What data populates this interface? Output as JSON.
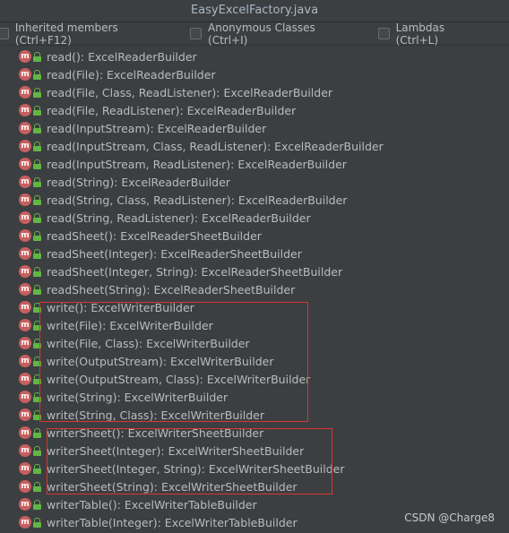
{
  "window": {
    "title": "EasyExcelFactory.java"
  },
  "options": [
    {
      "label": "Inherited members (Ctrl+F12)",
      "checked": false
    },
    {
      "label": "Anonymous Classes (Ctrl+I)",
      "checked": false
    },
    {
      "label": "Lambdas (Ctrl+L)",
      "checked": false
    }
  ],
  "icons": {
    "method": "method-icon",
    "visibility": "public-lock-icon"
  },
  "colors": {
    "method_icon": "#c75f5f",
    "lock_icon": "#62b543",
    "highlight_box": "#d9362f"
  },
  "members": [
    "read(): ExcelReaderBuilder",
    "read(File): ExcelReaderBuilder",
    "read(File, Class, ReadListener): ExcelReaderBuilder",
    "read(File, ReadListener): ExcelReaderBuilder",
    "read(InputStream): ExcelReaderBuilder",
    "read(InputStream, Class, ReadListener): ExcelReaderBuilder",
    "read(InputStream, ReadListener): ExcelReaderBuilder",
    "read(String): ExcelReaderBuilder",
    "read(String, Class, ReadListener): ExcelReaderBuilder",
    "read(String, ReadListener): ExcelReaderBuilder",
    "readSheet(): ExcelReaderSheetBuilder",
    "readSheet(Integer): ExcelReaderSheetBuilder",
    "readSheet(Integer, String): ExcelReaderSheetBuilder",
    "readSheet(String): ExcelReaderSheetBuilder",
    "write(): ExcelWriterBuilder",
    "write(File): ExcelWriterBuilder",
    "write(File, Class): ExcelWriterBuilder",
    "write(OutputStream): ExcelWriterBuilder",
    "write(OutputStream, Class): ExcelWriterBuilder",
    "write(String): ExcelWriterBuilder",
    "write(String, Class): ExcelWriterBuilder",
    "writerSheet(): ExcelWriterSheetBuilder",
    "writerSheet(Integer): ExcelWriterSheetBuilder",
    "writerSheet(Integer, String): ExcelWriterSheetBuilder",
    "writerSheet(String): ExcelWriterSheetBuilder",
    "writerTable(): ExcelWriterTableBuilder",
    "writerTable(Integer): ExcelWriterTableBuilder"
  ],
  "watermark": "CSDN @Charge8"
}
